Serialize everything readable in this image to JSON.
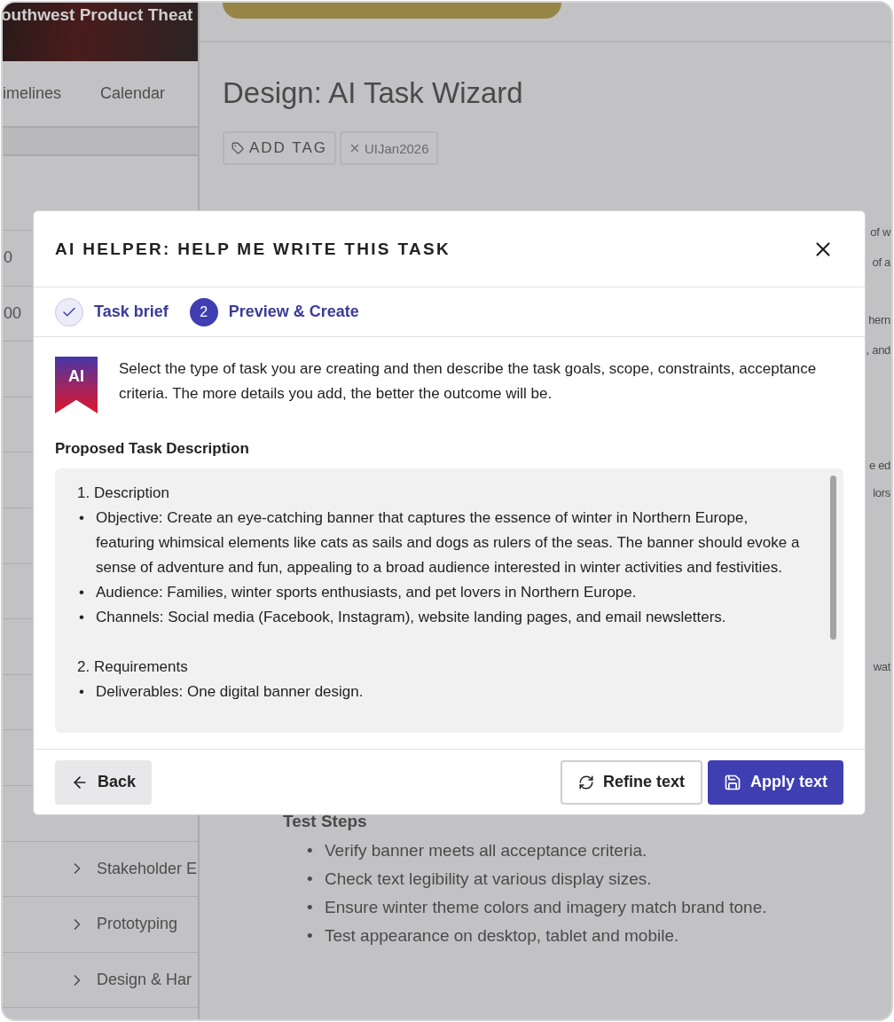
{
  "background": {
    "banner_title": "outhwest Product Theat",
    "tabs": [
      "imelines",
      "Calendar"
    ],
    "sidebar_fragments": [
      "0",
      "00"
    ],
    "sidebar_items": [
      "Stakeholder E",
      "Prototyping",
      "Design & Har"
    ],
    "page_title": "Design: AI Task Wizard",
    "add_tag": "ADD TAG",
    "tags": [
      "UIJan2026"
    ],
    "text_fragments": [
      "of w",
      "of a",
      "hern",
      ", and",
      "e ed",
      "lors",
      "wat"
    ],
    "test_steps": {
      "heading": "Test Steps",
      "marker": "•",
      "items": [
        "Verify banner meets all acceptance criteria.",
        "Check text legibility at various display sizes.",
        "Ensure winter theme colors and imagery match brand tone.",
        "Test appearance on desktop, tablet and mobile."
      ]
    }
  },
  "dialog": {
    "title": "AI HELPER: HELP ME WRITE THIS TASK",
    "steps": [
      {
        "kind": "done",
        "label": "Task brief"
      },
      {
        "kind": "current",
        "number": "2",
        "label": "Preview & Create"
      }
    ],
    "badge": "AI",
    "intro": "Select the type of task you are creating and then describe the task goals, scope, constraints, acceptance criteria. The more details you add, the better the outcome will be.",
    "section_label": "Proposed Task Description",
    "bullet_marker": "•",
    "sections": [
      {
        "number": "1.",
        "title": "Description",
        "bullets": [
          "Objective: Create an eye-catching banner that captures the essence of winter in Northern Europe, featuring whimsical elements like cats as sails and dogs as rulers of the seas. The banner should evoke a sense of adventure and fun, appealing to a broad audience interested in winter activities and festivities.",
          "Audience: Families, winter sports enthusiasts, and pet lovers in Northern Europe.",
          "Channels: Social media (Facebook, Instagram), website landing pages, and email newsletters."
        ]
      },
      {
        "number": "2.",
        "title": "Requirements",
        "bullets": [
          "Deliverables: One digital banner design."
        ]
      }
    ],
    "buttons": [
      {
        "kind": "back",
        "label": "Back"
      },
      {
        "kind": "refine",
        "label": "Refine text"
      },
      {
        "kind": "apply",
        "label": "Apply text"
      }
    ]
  }
}
